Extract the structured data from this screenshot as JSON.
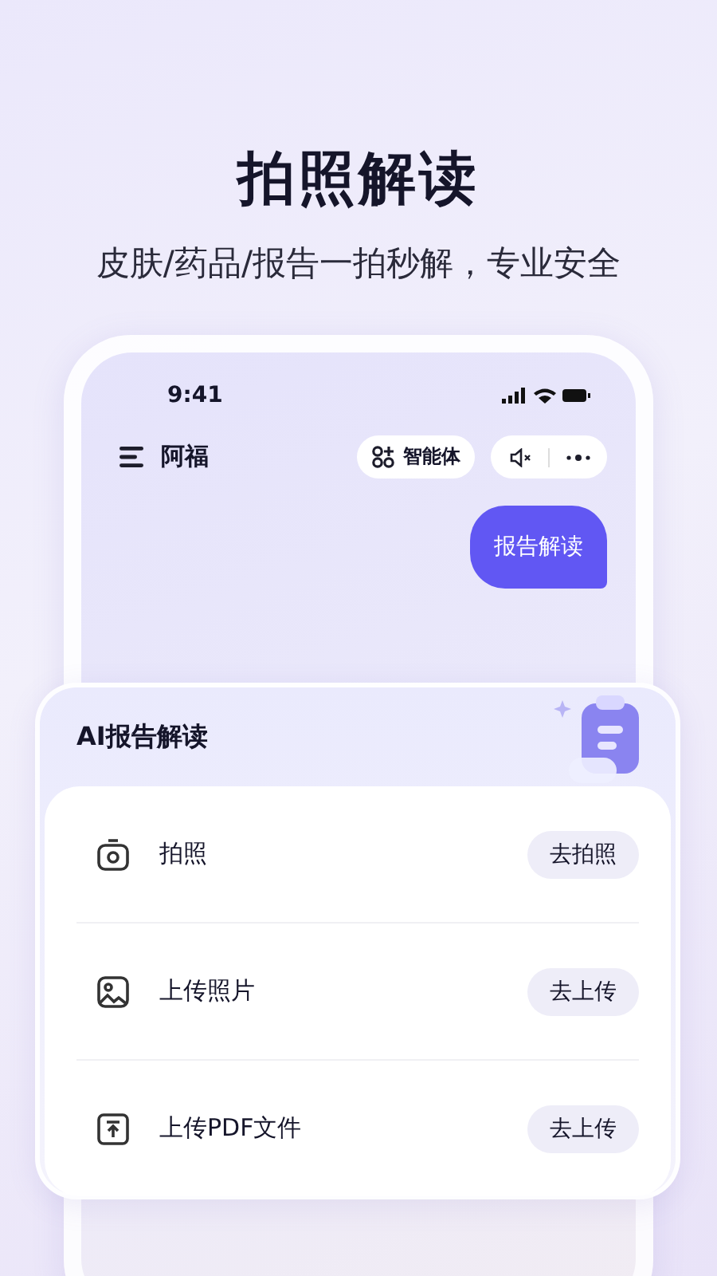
{
  "headline": "拍照解读",
  "subtitle": "皮肤/药品/报告一拍秒解，专业安全",
  "phone": {
    "status_bar": {
      "time": "9:41"
    },
    "nav": {
      "title": "阿福",
      "agent_button": "智能体"
    },
    "chat_bubble": "报告解读"
  },
  "panel": {
    "title": "AI报告解读",
    "options": [
      {
        "kind": "camera",
        "label": "拍照",
        "action": "去拍照"
      },
      {
        "kind": "image",
        "label": "上传照片",
        "action": "去上传"
      },
      {
        "kind": "pdf",
        "label": "上传PDF文件",
        "action": "去上传"
      }
    ]
  }
}
